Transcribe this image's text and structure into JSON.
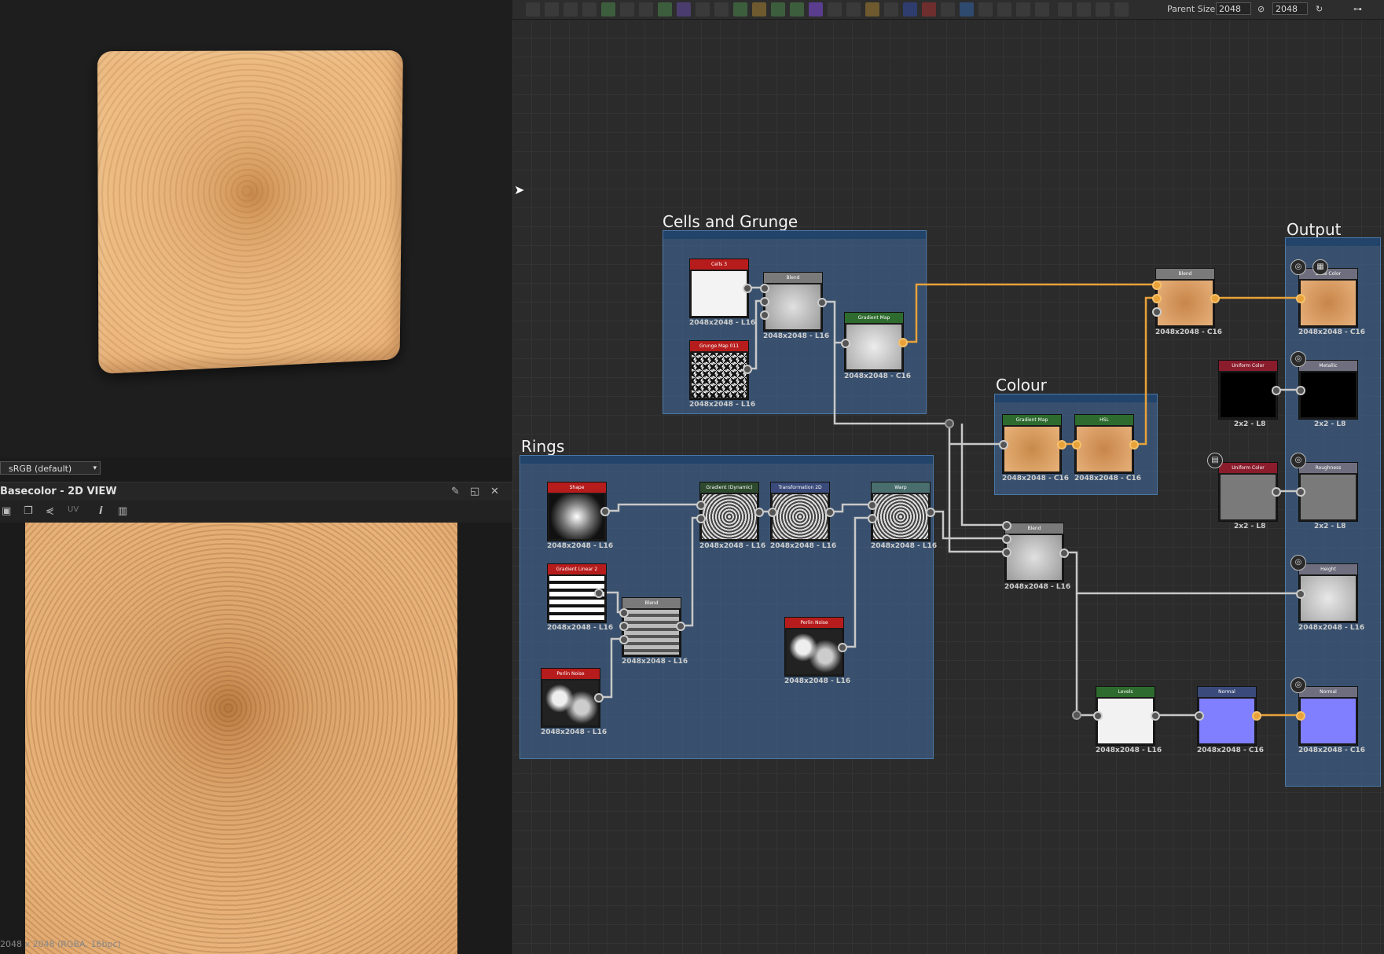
{
  "view3d": {},
  "colorspace": {
    "selected": "sRGB (default)"
  },
  "panel2d": {
    "title": "Basecolor - 2D VIEW",
    "uv_label": "UV",
    "info_icon": "i",
    "status": "2048 x 2048 (RGBA, 16bpc)"
  },
  "toolbar": {
    "parent_size_label": "Parent Size:",
    "parent_size_value": "2048",
    "output_size_value": "2048"
  },
  "frames": {
    "cells_grunge": "Cells and Grunge",
    "rings": "Rings",
    "colour": "Colour",
    "output": "Output"
  },
  "nodes": [
    {
      "id": "cells3",
      "label": "Cells 3",
      "caption": "2048x2048 - L16",
      "header_color": "#b71c1c"
    },
    {
      "id": "grunge",
      "label": "Grunge Map 011",
      "caption": "2048x2048 - L16",
      "header_color": "#b71c1c"
    },
    {
      "id": "blend1",
      "label": "Blend",
      "caption": "2048x2048 - L16",
      "header_color": "#7a7a7a"
    },
    {
      "id": "gradmap1",
      "label": "Gradient Map",
      "caption": "2048x2048 - C16",
      "header_color": "#2e6b2e"
    },
    {
      "id": "blend_top",
      "label": "Blend",
      "caption": "2048x2048 - C16",
      "header_color": "#7a7a7a"
    },
    {
      "id": "out_base",
      "label": "Base Color",
      "caption": "2048x2048 - C16",
      "header_color": "#6e6e7e"
    },
    {
      "id": "uni_metal",
      "label": "Uniform Color",
      "caption": "2x2 - L8",
      "header_color": "#8a1c2c"
    },
    {
      "id": "out_metal",
      "label": "Metallic",
      "caption": "2x2 - L8",
      "header_color": "#6e6e7e"
    },
    {
      "id": "gradmap2",
      "label": "Gradient Map",
      "caption": "2048x2048 - C16",
      "header_color": "#2e6b2e"
    },
    {
      "id": "hsl",
      "label": "HSL",
      "caption": "2048x2048 - C16",
      "header_color": "#2e6b2e"
    },
    {
      "id": "uni_rough",
      "label": "Uniform Color",
      "caption": "2x2 - L8",
      "header_color": "#8a1c2c"
    },
    {
      "id": "out_rough",
      "label": "Roughness",
      "caption": "2x2 - L8",
      "header_color": "#6e6e7e"
    },
    {
      "id": "shape",
      "label": "Shape",
      "caption": "2048x2048 - L16",
      "header_color": "#b71c1c"
    },
    {
      "id": "graddyn",
      "label": "Gradient (Dynamic)",
      "caption": "2048x2048 - L16",
      "header_color": "#2e4a2e"
    },
    {
      "id": "transform",
      "label": "Transformation 2D",
      "caption": "2048x2048 - L16",
      "header_color": "#3a4a7a"
    },
    {
      "id": "warp",
      "label": "Warp",
      "caption": "2048x2048 - L16",
      "header_color": "#4a6e6e"
    },
    {
      "id": "blend_mid",
      "label": "Blend",
      "caption": "2048x2048 - L16",
      "header_color": "#7a7a7a"
    },
    {
      "id": "out_height",
      "label": "Height",
      "caption": "2048x2048 - L16",
      "header_color": "#6e6e7e"
    },
    {
      "id": "gradlin",
      "label": "Gradient Linear 2",
      "caption": "2048x2048 - L16",
      "header_color": "#b71c1c"
    },
    {
      "id": "blend_r",
      "label": "Blend",
      "caption": "2048x2048 - L16",
      "header_color": "#7a7a7a"
    },
    {
      "id": "perlin2",
      "label": "Perlin Noise",
      "caption": "2048x2048 - L16",
      "header_color": "#b71c1c"
    },
    {
      "id": "perlin1",
      "label": "Perlin Noise",
      "caption": "2048x2048 - L16",
      "header_color": "#b71c1c"
    },
    {
      "id": "levels",
      "label": "Levels",
      "caption": "2048x2048 - L16",
      "header_color": "#2e6b2e"
    },
    {
      "id": "normal",
      "label": "Normal",
      "caption": "2048x2048 - C16",
      "header_color": "#3a4a7a"
    },
    {
      "id": "out_normal",
      "label": "Normal",
      "caption": "2048x2048 - C16",
      "header_color": "#6e6e7e"
    }
  ],
  "colors": {
    "link_color": "#e8a23a",
    "link_gray": "#c8c8c8",
    "frame_blue": "#40689a"
  }
}
